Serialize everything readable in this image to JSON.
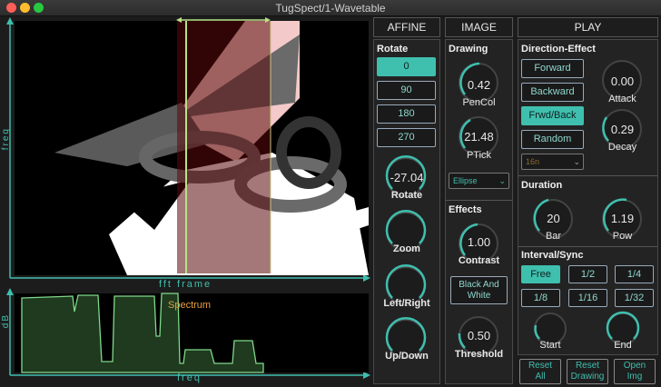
{
  "window": {
    "title": "TugSpect/1-Wavetable"
  },
  "axes": {
    "left_main": "freq",
    "bottom_main": "fft frame",
    "left_spec": "dB",
    "bottom_spec": "freq",
    "spectrum_label": "Spectrum"
  },
  "affine": {
    "header": "AFFINE",
    "rotate_section": "Rotate",
    "rotate_buttons": [
      "0",
      "90",
      "180",
      "270"
    ],
    "rotate_knob": {
      "value": "-27.04",
      "label": "Rotate"
    },
    "zoom_knob": {
      "label": "Zoom"
    },
    "leftright_knob": {
      "label": "Left/Right"
    },
    "updown_knob": {
      "label": "Up/Down"
    }
  },
  "image": {
    "header": "IMAGE",
    "drawing_section": "Drawing",
    "pencol_knob": {
      "value": "0.42",
      "label": "PenCol"
    },
    "ptick_knob": {
      "value": "21.48",
      "label": "PTick"
    },
    "shape_select": "Ellipse",
    "effects_section": "Effects",
    "contrast_knob": {
      "value": "1.00",
      "label": "Contrast"
    },
    "bw_button_line1": "Black And",
    "bw_button_line2": "White",
    "threshold_knob": {
      "value": "0.50",
      "label": "Threshold"
    }
  },
  "play": {
    "header": "PLAY",
    "direction_section": "Direction-Effect",
    "direction_buttons": [
      "Forward",
      "Backward",
      "Frwd/Back",
      "Random"
    ],
    "rate_select": "16n",
    "attack_knob": {
      "value": "0.00",
      "label": "Attack"
    },
    "decay_knob": {
      "value": "0.29",
      "label": "Decay"
    },
    "duration_section": "Duration",
    "bar_knob": {
      "value": "20",
      "label": "Bar"
    },
    "pow_knob": {
      "value": "1.19",
      "label": "Pow"
    },
    "interval_section": "Interval/Sync",
    "interval_buttons": [
      "Free",
      "1/2",
      "1/4",
      "1/8",
      "1/16",
      "1/32"
    ],
    "start_knob": {
      "label": "Start"
    },
    "end_knob": {
      "label": "End"
    }
  },
  "footer": {
    "reset_all": [
      "Reset",
      "All"
    ],
    "reset_drawing": [
      "Reset",
      "Drawing"
    ],
    "open_img": [
      "Open",
      "Img"
    ]
  },
  "colors": {
    "accent": "#3fbfae",
    "selection": "#5a0a0a",
    "spectrum_fill": "#1f3a1f"
  }
}
